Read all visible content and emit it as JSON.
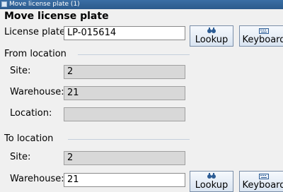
{
  "window": {
    "title": "Move license plate (1)"
  },
  "form": {
    "heading": "Move license plate",
    "license_plate": {
      "label": "License plate:",
      "value": "LP-015614"
    }
  },
  "from_location": {
    "title": "From location",
    "site": {
      "label": "Site:",
      "value": "2"
    },
    "warehouse": {
      "label": "Warehouse:",
      "value": "21"
    },
    "location": {
      "label": "Location:",
      "value": ""
    }
  },
  "to_location": {
    "title": "To location",
    "site": {
      "label": "Site:",
      "value": "2"
    },
    "warehouse": {
      "label": "Warehouse:",
      "value": "21"
    }
  },
  "buttons": {
    "lookup_1": {
      "label": "Lookup",
      "icon": "binoculars-icon"
    },
    "keyboard_1": {
      "label": "Keyboard",
      "icon": "keyboard-icon"
    },
    "lookup_2": {
      "label": "Lookup",
      "icon": "binoculars-icon"
    },
    "keyboard_2": {
      "label": "Keyboard",
      "icon": "keyboard-icon"
    }
  },
  "colors": {
    "titlebar": "#2b5a8c",
    "readonly_field": "#d8d8d8",
    "separator": "#c4cfdc"
  }
}
